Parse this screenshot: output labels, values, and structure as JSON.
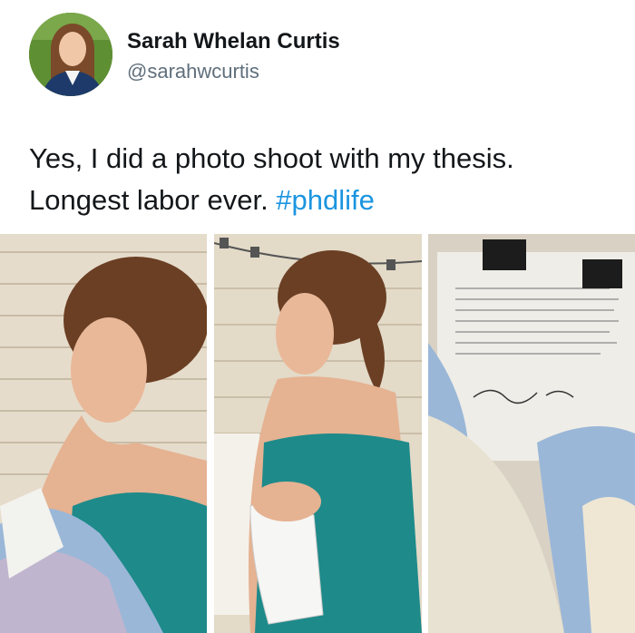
{
  "tweet": {
    "author_name": "Sarah Whelan Curtis",
    "author_handle": "@sarahwcurtis",
    "text_line1": "Yes, I did a photo shoot with my thesis.",
    "text_line2_plain": "Longest labor ever. ",
    "hashtag": "#phdlife"
  },
  "photos": [
    {
      "name": "photo-holding-thesis-swaddled"
    },
    {
      "name": "photo-cradling-thesis-profile"
    },
    {
      "name": "photo-thesis-in-blanket-closeup"
    }
  ],
  "colors": {
    "hashtag": "#1b95e0",
    "dress": "#1e8a8a",
    "blanket_blue": "#9ab7d8"
  }
}
